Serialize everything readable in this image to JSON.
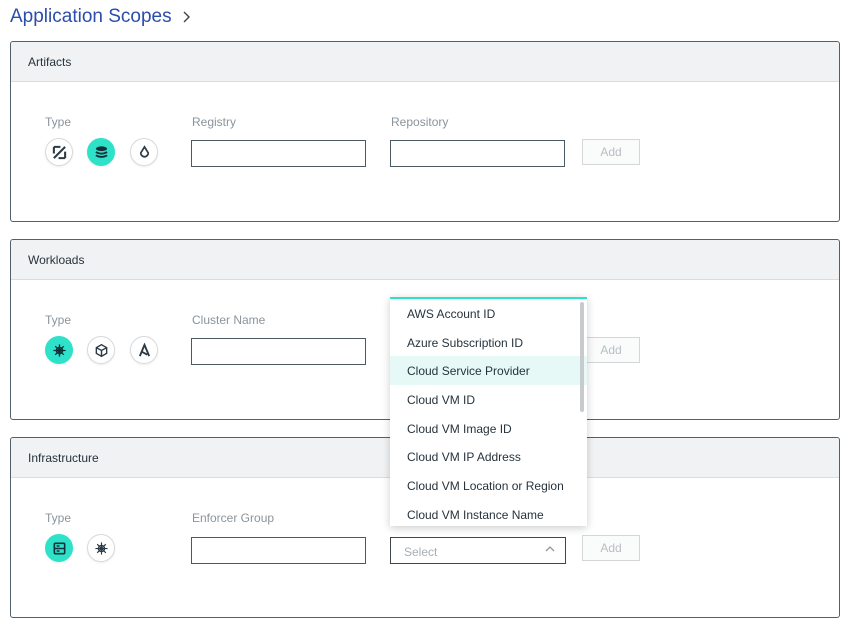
{
  "page": {
    "title": "Application Scopes"
  },
  "sections": {
    "artifacts": {
      "header": "Artifacts",
      "type_label": "Type",
      "field1_label": "Registry",
      "field2_label": "Repository",
      "add_label": "Add",
      "icons": [
        "percent-tag-icon",
        "layers-icon",
        "droplet-icon"
      ],
      "active_icon": "layers-icon"
    },
    "workloads": {
      "header": "Workloads",
      "type_label": "Type",
      "field1_label": "Cluster Name",
      "add_label": "Add",
      "icons": [
        "helm-wheel-icon",
        "cube-icon",
        "arrow-a-icon"
      ],
      "active_icon": "helm-wheel-icon"
    },
    "infrastructure": {
      "header": "Infrastructure",
      "type_label": "Type",
      "field1_label": "Enforcer Group",
      "select_placeholder": "Select",
      "add_label": "Add",
      "icons": [
        "server-icon",
        "helm-wheel-icon"
      ],
      "active_icon": "server-icon"
    }
  },
  "dropdown": {
    "items": [
      "AWS Account ID",
      "Azure Subscription ID",
      "Cloud Service Provider",
      "Cloud VM ID",
      "Cloud VM Image ID",
      "Cloud VM IP Address",
      "Cloud VM Location or Region",
      "Cloud VM Instance Name"
    ],
    "highlighted": "Cloud Service Provider"
  },
  "colors": {
    "accent": "#2de2c8",
    "title": "#2b4dab",
    "border": "#51606b"
  }
}
